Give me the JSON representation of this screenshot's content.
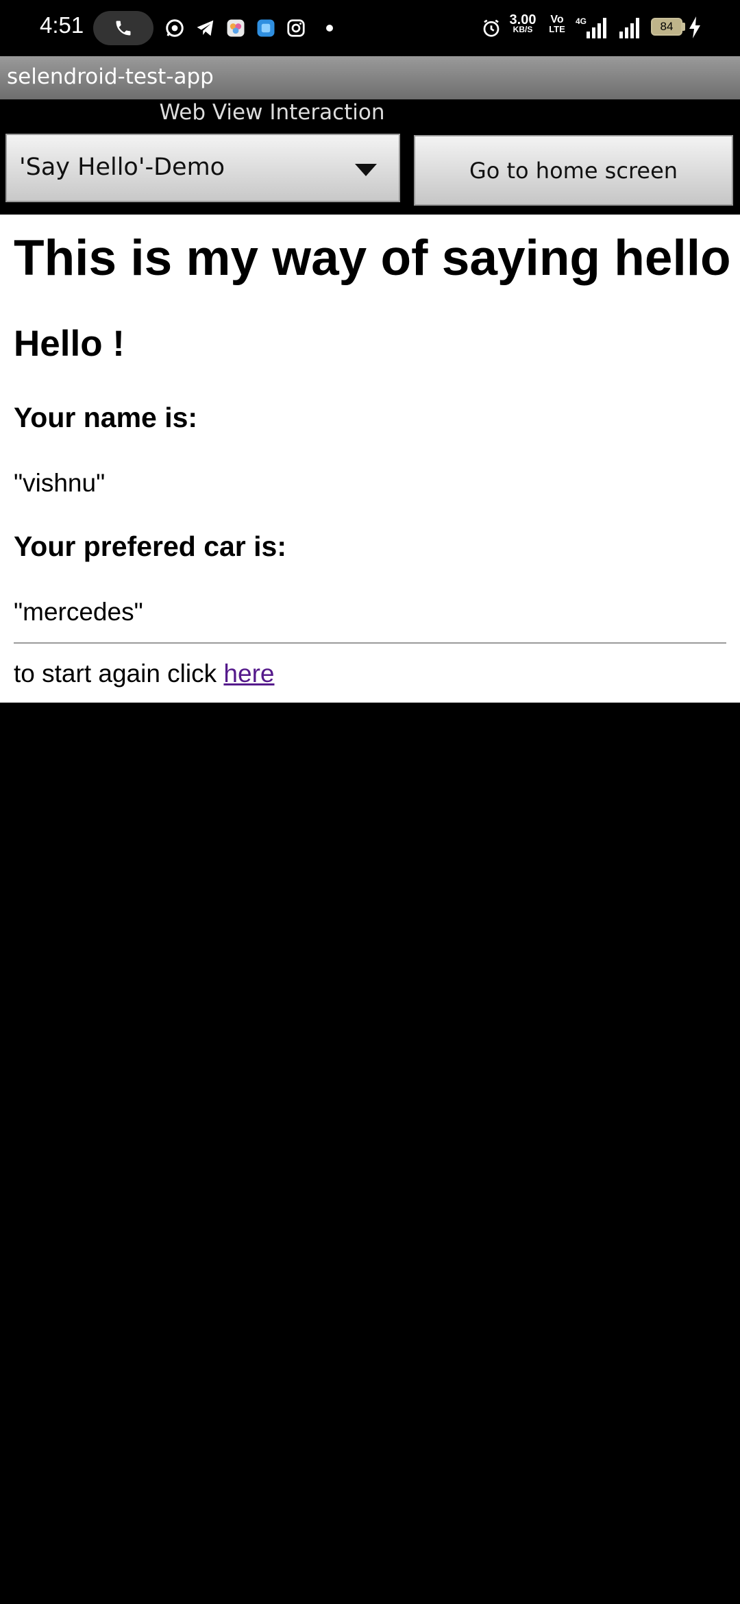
{
  "status_bar": {
    "time": "4:51",
    "network_speed": "3.00",
    "network_speed_unit": "KB/S",
    "volte_top": "Vo",
    "volte_bottom": "LTE",
    "network_type": "4G",
    "battery_level": "84",
    "icons": [
      "call-icon",
      "whatsapp-icon",
      "telegram-icon",
      "photos-icon",
      "app-icon",
      "instagram-icon",
      "alarm-icon",
      "signal-icon",
      "signal-icon-2",
      "charging-icon"
    ]
  },
  "app_bar": {
    "title": "selendroid-test-app"
  },
  "subtitle": "Web View Interaction",
  "spinner": {
    "selected": "'Say Hello'-Demo"
  },
  "home_button": {
    "label": "Go to home screen"
  },
  "webview": {
    "heading": "This is my way of saying hello",
    "greeting": "Hello !",
    "name_label": "Your name is:",
    "name_value": "\"vishnu\"",
    "car_label": "Your prefered car is:",
    "car_value": "\"mercedes\"",
    "restart_text": "to start again click",
    "restart_link": "here"
  },
  "colors": {
    "link": "#551a8b",
    "background": "#000000",
    "webview": "#ffffff",
    "battery": "#bfb48a"
  }
}
